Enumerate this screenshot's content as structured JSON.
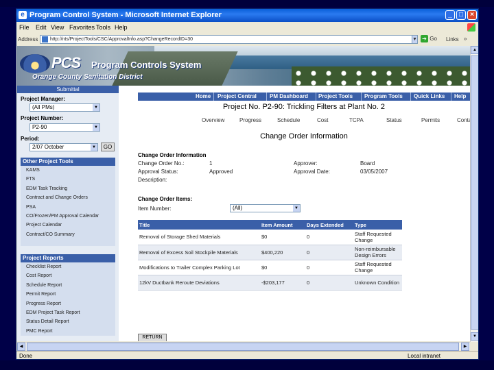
{
  "window": {
    "title": "Program Control System - Microsoft Internet Explorer",
    "min_glyph": "_",
    "max_glyph": "□",
    "close_glyph": "×"
  },
  "menu": [
    "File",
    "Edit",
    "View",
    "Favorites",
    "Tools",
    "Help"
  ],
  "address": {
    "label": "Address",
    "url": "http://nts/ProjectTools/CSC/ApprovalInfo.asp?ChangeRecordID=30",
    "go": "Go",
    "links": "Links"
  },
  "banner": {
    "logo_text": "PCS",
    "system_name": "Program Controls System",
    "district": "Orange County Sanitation District"
  },
  "sidebar": {
    "header": "Submittal",
    "project_manager_label": "Project Manager:",
    "project_manager_value": "(All PMs)",
    "project_number_label": "Project Number:",
    "project_number_value": "P2-90",
    "period_label": "Period:",
    "period_value": "2/07 October",
    "go_button": "GO",
    "other_tools_header": "Other Project Tools",
    "other_tools": [
      "KAMS",
      "FTS",
      "EDM Task Tracking",
      "Contract and Change Orders",
      "PSA",
      "CO/Frozen/PM Approval Calendar",
      "Project Calendar",
      "Contract/CO Summary"
    ],
    "reports_header": "Project Reports",
    "reports": [
      "Checklist Report",
      "Cost Report",
      "Schedule Report",
      "Permit Report",
      "Progress Report",
      "EDM Project Task Report",
      "Status Detail Report",
      "PMC Report"
    ]
  },
  "topnav": [
    "Home",
    "Project Central",
    "PM Dashboard",
    "Project Tools",
    "Program Tools",
    "Quick Links",
    "Help"
  ],
  "project_title": "Project No. P2-90: Trickling Filters at Plant No. 2",
  "subnav": [
    "Overview",
    "Progress",
    "Schedule",
    "Cost",
    "TCPA",
    "Status",
    "Permits",
    "Contacts"
  ],
  "page_heading": "Change Order Information",
  "co_info": {
    "section": "Change Order Information",
    "co_no_label": "Change Order No.:",
    "co_no_value": "1",
    "status_label": "Approval Status:",
    "status_value": "Approved",
    "description_label": "Description:",
    "approver_label": "Approver:",
    "approver_value": "Board",
    "approval_date_label": "Approval Date:",
    "approval_date_value": "03/05/2007"
  },
  "co_items": {
    "section": "Change Order Items:",
    "item_number_label": "Item Number:",
    "item_number_value": "(All)",
    "columns": [
      "Title",
      "Item Amount",
      "Days Extended",
      "Type"
    ],
    "rows": [
      [
        "Removal of Storage Shed Materials",
        "$0",
        "0",
        "Staff Requested Change"
      ],
      [
        "Removal of Excess Soil Stockpile Materials",
        "$400,220",
        "0",
        "Non-reimbursable Design Errors"
      ],
      [
        "Modifications to Trailer Complex Parking Lot",
        "$0",
        "0",
        "Staff Requested Change"
      ],
      [
        "12kV Ductbank Reroute Deviations",
        "-$203,177",
        "0",
        "Unknown Condition"
      ]
    ]
  },
  "return_button": "RETURN",
  "status": {
    "left": "Done",
    "right": "Local intranet"
  }
}
